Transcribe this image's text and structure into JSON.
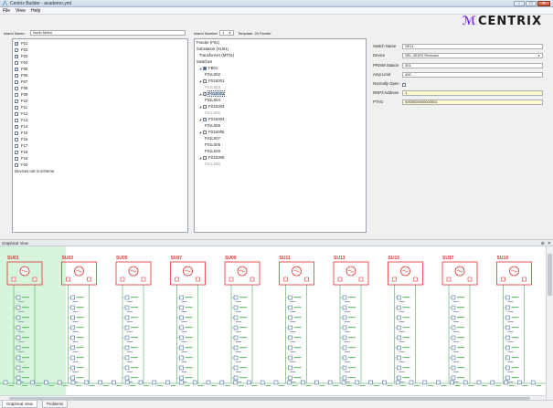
{
  "window": {
    "title": "Centrix Builder - academo.yml",
    "minimize": "–",
    "maximize": "□",
    "close": "✕"
  },
  "menu": [
    "File",
    "View",
    "Help"
  ],
  "header": {
    "island_name_label": "Island Name:",
    "island_name_value": "North Metro",
    "island_number_label": "Island Number",
    "island_number_value": "1",
    "template_label": "Template: 20 Feeder",
    "logo_text": "CENTRIX"
  },
  "feeders": {
    "items": [
      {
        "label": "F01",
        "checked": true
      },
      {
        "label": "F02",
        "checked": false
      },
      {
        "label": "F03",
        "checked": true
      },
      {
        "label": "F04",
        "checked": false
      },
      {
        "label": "F05",
        "checked": true
      },
      {
        "label": "F06",
        "checked": false
      },
      {
        "label": "F07",
        "checked": false
      },
      {
        "label": "F08",
        "checked": false
      },
      {
        "label": "F09",
        "checked": false
      },
      {
        "label": "F10",
        "checked": false
      },
      {
        "label": "F11",
        "checked": false
      },
      {
        "label": "F12",
        "checked": false
      },
      {
        "label": "F13",
        "checked": false
      },
      {
        "label": "F14",
        "checked": false
      },
      {
        "label": "F15",
        "checked": false
      },
      {
        "label": "F16",
        "checked": false
      },
      {
        "label": "F17",
        "checked": false
      },
      {
        "label": "F18",
        "checked": false
      },
      {
        "label": "F19",
        "checked": false
      },
      {
        "label": "F20",
        "checked": false
      }
    ],
    "footer_label": "Devices not in scheme"
  },
  "tree": {
    "rows": [
      {
        "text": "Feeder (F01)",
        "indent": 0,
        "type": "text"
      },
      {
        "text": "Substation (SU01)",
        "indent": 0,
        "type": "text"
      },
      {
        "text": "Transformer (MT01)",
        "indent": 3,
        "type": "text"
      },
      {
        "text": "Switches",
        "indent": 0,
        "type": "text"
      },
      {
        "text": "FB01",
        "indent": 3,
        "type": "node",
        "checked": true
      },
      {
        "text": "F01L002",
        "indent": 9,
        "type": "text"
      },
      {
        "text": "F01S001",
        "indent": 3,
        "type": "node",
        "checked": false
      },
      {
        "text": "F01L003",
        "indent": 9,
        "type": "grey"
      },
      {
        "text": "F01S002",
        "indent": 3,
        "type": "node",
        "checked": true,
        "selected": true
      },
      {
        "text": "F01L004",
        "indent": 9,
        "type": "text"
      },
      {
        "text": "F01S003",
        "indent": 3,
        "type": "node",
        "checked": false
      },
      {
        "text": "F01L005",
        "indent": 9,
        "type": "grey"
      },
      {
        "text": "F01S004",
        "indent": 3,
        "type": "node",
        "checked": true
      },
      {
        "text": "F01L006",
        "indent": 9,
        "type": "text"
      },
      {
        "text": "F01S005",
        "indent": 3,
        "type": "node",
        "checked": false
      },
      {
        "text": "F01L007",
        "indent": 9,
        "type": "text"
      },
      {
        "text": "F01L008",
        "indent": 9,
        "type": "text"
      },
      {
        "text": "F01L029",
        "indent": 9,
        "type": "text"
      },
      {
        "text": "F01S006",
        "indent": 3,
        "type": "node",
        "checked": false
      },
      {
        "text": "F01L030",
        "indent": 9,
        "type": "grey"
      }
    ]
  },
  "properties": {
    "switch_name_label": "Switch Name",
    "switch_name_value": "SE11",
    "device_label": "Device",
    "device_value": "SEL 351R2 Recloser",
    "prism_station_label": "PRISM Station",
    "prism_station_value": "301",
    "amp_limit_label": "Amp Limit",
    "amp_limit_value": "400",
    "normally_open_label": "Normally Open",
    "normally_open_checked": false,
    "dnp3_address_label": "DNP3 Address",
    "dnp3_address_value": "1",
    "ptag_label": "PTAG",
    "ptag_value": "0000000000000001"
  },
  "graphical_view": {
    "title": "Graphical View",
    "pin_icon": "pin-icon",
    "close_icon": "close-icon",
    "substations": [
      "SU01",
      "SU03",
      "SU05",
      "SU07",
      "SU09",
      "SU11",
      "SU13",
      "SU15",
      "SU17",
      "SU19"
    ]
  },
  "tabs": [
    {
      "label": "Graphical View",
      "active": true
    },
    {
      "label": "Problems",
      "active": false
    }
  ],
  "colors": {
    "substation_red": "#e03131",
    "line_green": "#2f9e44",
    "switch_blue": "#4a6fa5",
    "highlight_green": "#d6f5dc",
    "field_yellow": "#fffbd1"
  }
}
